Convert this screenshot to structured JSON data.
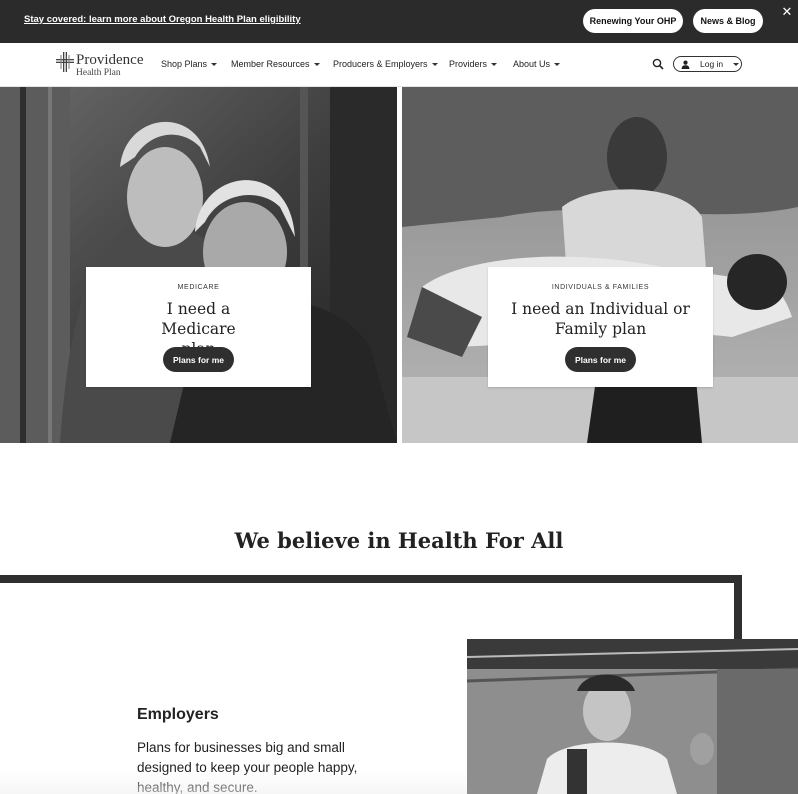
{
  "banner": {
    "link_text": "Stay covered: learn more about Oregon Health Plan eligibility",
    "renew_label": "Renewing Your OHP",
    "news_label": "News & Blog",
    "close_icon": "close-icon",
    "close_glyph": "✕"
  },
  "logo": {
    "name": "Providence",
    "sub": "Health Plan"
  },
  "nav": {
    "items": [
      {
        "label": "Shop Plans"
      },
      {
        "label": "Member Resources"
      },
      {
        "label": "Producers & Employers"
      },
      {
        "label": "Providers"
      },
      {
        "label": "About Us"
      }
    ],
    "search_icon": "search-icon",
    "login_label": "Log in"
  },
  "hero": {
    "left": {
      "eyebrow": "MEDICARE",
      "title": "I need a Medicare plan",
      "button": "Plans for me"
    },
    "right": {
      "eyebrow": "INDIVIDUALS & FAMILIES",
      "title": "I need an Individual or Family plan",
      "button": "Plans for me"
    }
  },
  "belief": {
    "title": "We believe in Health For All"
  },
  "employers": {
    "title": "Employers",
    "description": "Plans for businesses big and small designed to keep your people happy, healthy, and secure."
  },
  "colors": {
    "banner_bg": "#2b2b2b",
    "button_dark": "#2f2f2f",
    "text": "#222222"
  }
}
